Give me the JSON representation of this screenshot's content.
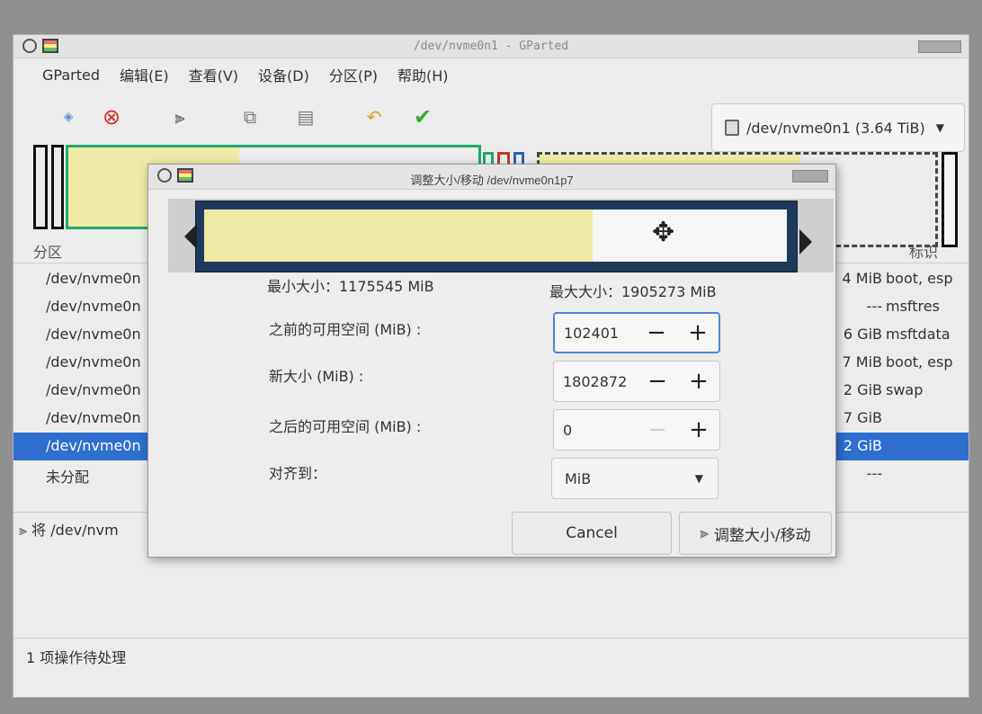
{
  "window": {
    "title": "/dev/nvme0n1 - GParted"
  },
  "menu": {
    "items": [
      "GParted",
      "编辑(E)",
      "查看(V)",
      "设备(D)",
      "分区(P)",
      "帮助(H)"
    ]
  },
  "toolbar": {
    "icons": [
      "new-icon",
      "delete-icon",
      "resize-move-icon",
      "copy-icon",
      "paste-icon",
      "undo-icon",
      "apply-icon"
    ]
  },
  "device": {
    "label": "/dev/nvme0n1 (3.64 TiB)"
  },
  "list": {
    "header_partition": "分区",
    "header_flags": "标识",
    "rows": [
      {
        "partition": "/dev/nvme0n",
        "size": "4 MiB",
        "flags": "boot, esp"
      },
      {
        "partition": "/dev/nvme0n",
        "size": "---",
        "flags": "msftres"
      },
      {
        "partition": "/dev/nvme0n",
        "size": "6 GiB",
        "flags": "msftdata"
      },
      {
        "partition": "/dev/nvme0n",
        "size": "7 MiB",
        "flags": "boot, esp"
      },
      {
        "partition": "/dev/nvme0n",
        "size": "2 GiB",
        "flags": "swap"
      },
      {
        "partition": "/dev/nvme0n",
        "size": "7 GiB",
        "flags": ""
      },
      {
        "partition": "/dev/nvme0n",
        "size": "2 GiB",
        "flags": ""
      },
      {
        "partition": "未分配",
        "size": "---",
        "flags": ""
      }
    ],
    "selected_index": 6
  },
  "pending": {
    "operation": "将 /dev/nvm"
  },
  "status": {
    "text": "1 项操作待处理"
  },
  "dialog": {
    "title": "调整大小/移动 /dev/nvme0n1p7",
    "min_size": "最小大小：1175545  MiB",
    "max_size": "最大大小：1905273  MiB",
    "before_label": "之前的可用空间 (MiB) :",
    "before_value": "102401",
    "new_size_label": "新大小 (MiB) :",
    "new_size_value": "1802872",
    "after_label": "之后的可用空间 (MiB) :",
    "after_value": "0",
    "align_label": "对齐到：",
    "align_value": "MiB",
    "cancel": "Cancel",
    "confirm": "调整大小/移动",
    "minus": "−",
    "plus": "+"
  }
}
